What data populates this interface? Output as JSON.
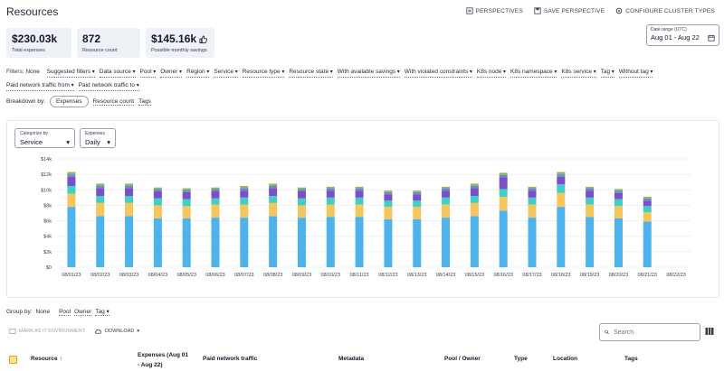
{
  "header": {
    "title": "Resources",
    "actions": [
      "PERSPECTIVES",
      "SAVE PERSPECTIVE",
      "CONFIGURE CLUSTER TYPES"
    ]
  },
  "summary": [
    {
      "value": "$230.03k",
      "label": "Total expenses"
    },
    {
      "value": "872",
      "label": "Resource count"
    },
    {
      "value": "$145.16k",
      "label": "Possible monthly savings",
      "icon": "thumbs-up-icon"
    }
  ],
  "date_range": {
    "label": "Date range (UTC)",
    "value": "Aug 01 - Aug 22"
  },
  "filters": {
    "label": "Filters:",
    "none": "None",
    "items": [
      "Suggested filters",
      "Data source",
      "Pool",
      "Owner",
      "Region",
      "Service",
      "Resource type",
      "Resource state",
      "With available savings",
      "With violated constraints",
      "K8s node",
      "K8s namespace",
      "K8s service",
      "Tag",
      "Without tag",
      "Paid network traffic from",
      "Paid network traffic to"
    ]
  },
  "breakdown": {
    "label": "Breakdown by:",
    "active": "Expenses",
    "options": [
      "Resource count",
      "Tags"
    ]
  },
  "categorize": {
    "label": "Categorize by",
    "value": "Service"
  },
  "expenses_select": {
    "label": "Expenses",
    "value": "Daily"
  },
  "chart_data": {
    "type": "bar",
    "stacked": true,
    "categories": [
      "08/01/23",
      "08/02/23",
      "08/03/23",
      "08/04/23",
      "08/05/23",
      "08/06/23",
      "08/07/23",
      "08/08/23",
      "08/09/23",
      "08/10/23",
      "08/11/23",
      "08/12/23",
      "08/13/23",
      "08/14/23",
      "08/15/23",
      "08/16/23",
      "08/17/23",
      "08/18/23",
      "08/19/23",
      "08/20/23",
      "08/21/23",
      "08/22/23"
    ],
    "y_ticks": [
      "$0",
      "$2k",
      "$4k",
      "$6k",
      "$8k",
      "$10k",
      "$12k",
      "$14k"
    ],
    "ylim": [
      0,
      14000
    ],
    "series_colors": [
      "#4db3ec",
      "#f7c55a",
      "#3fcfc6",
      "#7b4fc9",
      "#6a8acb",
      "#8dbd4f"
    ],
    "series": [
      {
        "values": [
          7800,
          6600,
          6600,
          6300,
          6300,
          6400,
          6400,
          6600,
          6400,
          6500,
          6500,
          6200,
          6200,
          6400,
          6600,
          7300,
          6400,
          7800,
          6500,
          6300,
          5900,
          0
        ]
      },
      {
        "values": [
          1700,
          1700,
          1700,
          1700,
          1600,
          1700,
          1700,
          1700,
          1600,
          1600,
          1600,
          1600,
          1600,
          1700,
          1700,
          1800,
          1700,
          1800,
          1600,
          1600,
          1200,
          0
        ]
      },
      {
        "values": [
          1000,
          900,
          900,
          900,
          900,
          800,
          900,
          900,
          900,
          900,
          900,
          800,
          800,
          900,
          900,
          1000,
          900,
          1100,
          900,
          900,
          800,
          0
        ]
      },
      {
        "values": [
          1200,
          1000,
          1000,
          900,
          900,
          900,
          900,
          1000,
          900,
          900,
          900,
          800,
          800,
          900,
          1000,
          1500,
          900,
          1000,
          900,
          800,
          700,
          0
        ]
      },
      {
        "values": [
          300,
          300,
          300,
          300,
          300,
          300,
          300,
          300,
          300,
          300,
          300,
          300,
          300,
          300,
          300,
          300,
          300,
          300,
          300,
          300,
          300,
          0
        ]
      },
      {
        "values": [
          300,
          300,
          300,
          200,
          200,
          200,
          300,
          300,
          200,
          200,
          200,
          200,
          200,
          200,
          300,
          300,
          200,
          300,
          200,
          200,
          200,
          0
        ]
      }
    ]
  },
  "group_by": {
    "label": "Group by:",
    "none": "None",
    "options": [
      "Pool",
      "Owner",
      "Tag"
    ]
  },
  "actions": {
    "mark": "MARK AS IT ENVIRONMENT",
    "download": "DOWNLOAD"
  },
  "search": {
    "placeholder": "Search"
  },
  "table": {
    "columns": [
      "Resource",
      "Expenses (Aug 01 - Aug 22)",
      "Paid network traffic",
      "Metadata",
      "Pool / Owner",
      "Type",
      "Location",
      "Tags"
    ]
  }
}
